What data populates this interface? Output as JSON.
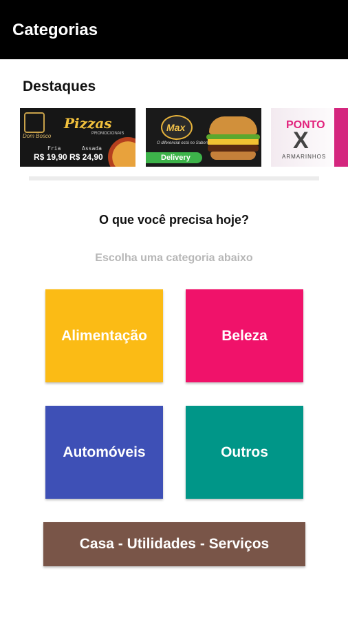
{
  "appbar": {
    "title": "Categorias"
  },
  "featured": {
    "title": "Destaques",
    "banners": [
      {
        "logo_text": "Dom Bosco",
        "title": "Pizzas",
        "subtitle": "PROMOCIONAIS",
        "label_1": "Fria",
        "label_2": "Assada",
        "price_1": "R$ 19,90",
        "price_2": "R$ 24,90"
      },
      {
        "badge": "Max",
        "tagline": "O diferencial está no Sabor!",
        "delivery": "Delivery"
      },
      {
        "title": "PONTO",
        "mark": "X",
        "subtitle": "ARMARINHOS"
      }
    ]
  },
  "prompt": {
    "question": "O que você precisa hoje?",
    "hint": "Escolha uma categoria abaixo"
  },
  "categories": [
    {
      "label": "Alimentação",
      "color": "#FBBB15"
    },
    {
      "label": "Beleza",
      "color": "#F0126A"
    },
    {
      "label": "Automóveis",
      "color": "#3E50B6"
    },
    {
      "label": "Outros",
      "color": "#009688"
    },
    {
      "label": "Casa - Utilidades - Serviços",
      "color": "#795548"
    }
  ],
  "colors": {
    "appbar": "#000000",
    "divider": "#ECECEC"
  }
}
